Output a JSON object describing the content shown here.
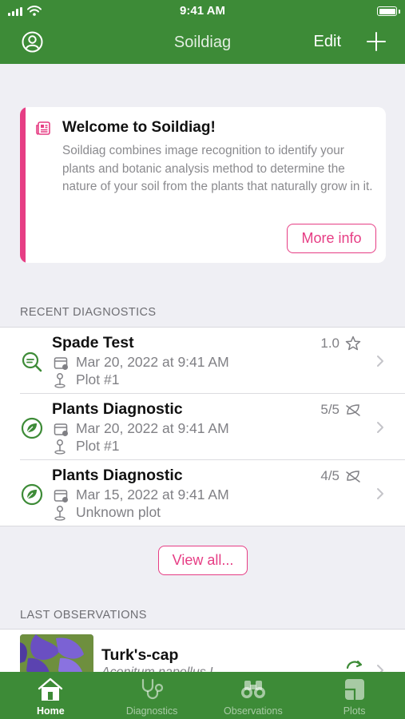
{
  "status_bar": {
    "time": "9:41 AM"
  },
  "nav": {
    "title": "Soildiag",
    "edit_label": "Edit"
  },
  "welcome": {
    "title": "Welcome to Soildiag!",
    "body": "Soildiag combines image recognition to identify your plants and botanic analysis method to determine the nature of your soil from the plants that naturally grow in it.",
    "button": "More info"
  },
  "recent": {
    "header": "RECENT DIAGNOSTICS",
    "items": [
      {
        "title": "Spade Test",
        "date": "Mar 20, 2022 at 9:41 AM",
        "plot": "Plot #1",
        "score": "1.0",
        "icon": "magnifier-leaf-icon",
        "badge": "star-icon"
      },
      {
        "title": "Plants Diagnostic",
        "date": "Mar 20, 2022 at 9:41 AM",
        "plot": "Plot #1",
        "score": "5/5",
        "icon": "leaf-circle-icon",
        "badge": "leaf-outline-icon"
      },
      {
        "title": "Plants Diagnostic",
        "date": "Mar 15, 2022 at 9:41 AM",
        "plot": "Unknown plot",
        "score": "4/5",
        "icon": "leaf-circle-icon",
        "badge": "leaf-outline-icon"
      }
    ],
    "view_all": "View all..."
  },
  "observations": {
    "header": "LAST OBSERVATIONS",
    "items": [
      {
        "name": "Turk's-cap",
        "scientific": "Aconitum napellus L."
      }
    ]
  },
  "tabs": [
    {
      "label": "Home",
      "icon": "house-icon",
      "active": true
    },
    {
      "label": "Diagnostics",
      "icon": "stethoscope-icon",
      "active": false
    },
    {
      "label": "Observations",
      "icon": "binoculars-icon",
      "active": false
    },
    {
      "label": "Plots",
      "icon": "plots-icon",
      "active": false
    }
  ],
  "colors": {
    "brand_green": "#3d8b37",
    "accent_pink": "#e63d84",
    "background": "#efeff4"
  }
}
